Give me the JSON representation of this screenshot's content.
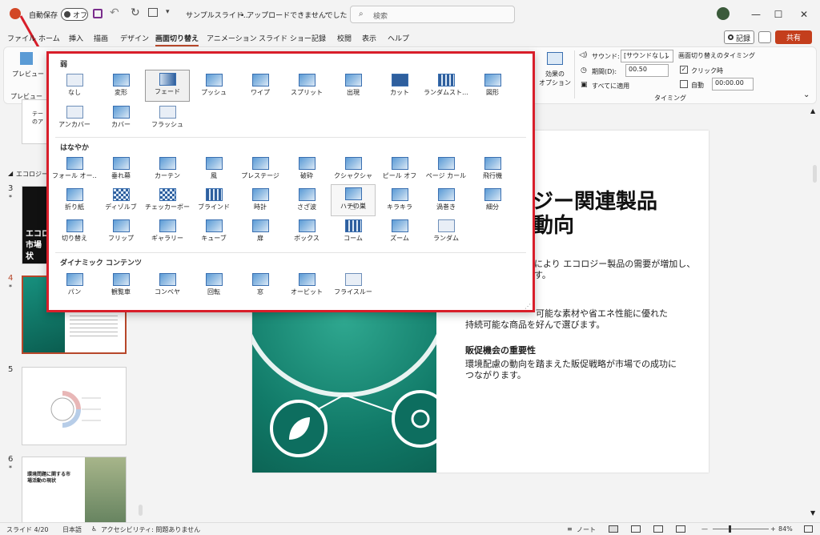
{
  "titlebar": {
    "autosave_label": "自動保存",
    "autosave_state": "オフ",
    "filename": "サンプルスライド…",
    "upload_status": "• アップロードできませんでした",
    "search_placeholder": "検索"
  },
  "menu": {
    "tabs": [
      "ファイル",
      "ホーム",
      "挿入",
      "描画",
      "デザイン",
      "画面切り替え",
      "アニメーション",
      "スライド ショー",
      "記録",
      "校閲",
      "表示",
      "ヘルプ"
    ],
    "active": "画面切り替え",
    "record_button": "記録",
    "share_button": "共有"
  },
  "ribbon": {
    "preview_label": "プレビュー",
    "preview_group": "プレビュー",
    "effect_options": [
      "効果の",
      "オプション"
    ],
    "sound_label": "サウンド:",
    "sound_value": "[サウンドなし]",
    "duration_label": "期間(D):",
    "duration_value": "00.50",
    "apply_all": "すべてに適用",
    "timing_header": "画面切り替えのタイミング",
    "on_click": "クリック時",
    "auto_label": "自動",
    "auto_value": "00:00.00",
    "timing_group": "タイミング"
  },
  "gallery": {
    "sections": [
      {
        "title": "弱",
        "items": [
          "なし",
          "変形",
          "フェード",
          "プッシュ",
          "ワイプ",
          "スプリット",
          "出現",
          "カット",
          "ランダムスト…",
          "図形",
          "アンカバー",
          "カバー",
          "フラッシュ"
        ]
      },
      {
        "title": "はなやか",
        "items": [
          "フォール オー…",
          "垂れ幕",
          "カーテン",
          "風",
          "プレステージ",
          "破砕",
          "クシャクシャ",
          "ピール オフ",
          "ページ カール",
          "飛行機",
          "折り紙",
          "ディゾルブ",
          "チェッカーボード",
          "ブラインド",
          "時計",
          "さざ波",
          "ハチの巣",
          "キラキラ",
          "渦巻き",
          "細分",
          "切り替え",
          "フリップ",
          "ギャラリー",
          "キューブ",
          "扉",
          "ボックス",
          "コーム",
          "ズーム",
          "ランダム"
        ]
      },
      {
        "title": "ダイナミック コンテンツ",
        "items": [
          "パン",
          "観覧車",
          "コンベヤ",
          "回転",
          "窓",
          "オービット",
          "フライスルー"
        ]
      }
    ],
    "selected": "フェード",
    "hovered": "ハチの巣"
  },
  "slide_panel": {
    "section_label": "エコロジー",
    "slide_numbers": [
      "3",
      "4",
      "5",
      "6"
    ],
    "thumb3_text": [
      "エコロ",
      "市場",
      "状"
    ],
    "thumb2_partial": [
      "テー",
      "のア"
    ],
    "thumb6_text": [
      "環境問題に関する市",
      "場活動の現状"
    ]
  },
  "main_slide": {
    "title_line1": "ジー関連製品",
    "title_line2": "動向",
    "para1_line1": "により エコロジー製品の需要が増加し、",
    "para1_line2": "す。",
    "para2_line1": "可能な素材や省エネ性能に優れた",
    "para2_line2": "持続可能な商品を好んで選びます。",
    "heading3": "販促機会の重要性",
    "para3_line1": "環境配慮の動向を踏まえた販促戦略が市場での成功に",
    "para3_line2": "つながります。"
  },
  "statusbar": {
    "slide_info": "スライド 4/20",
    "language": "日本語",
    "accessibility": "アクセシビリティ: 問題ありません",
    "notes": "ノート",
    "zoom": "84%"
  },
  "colors": {
    "accent_red": "#d81e2a",
    "share_orange": "#c43e1c",
    "slide_teal": "#0f7a6a"
  }
}
